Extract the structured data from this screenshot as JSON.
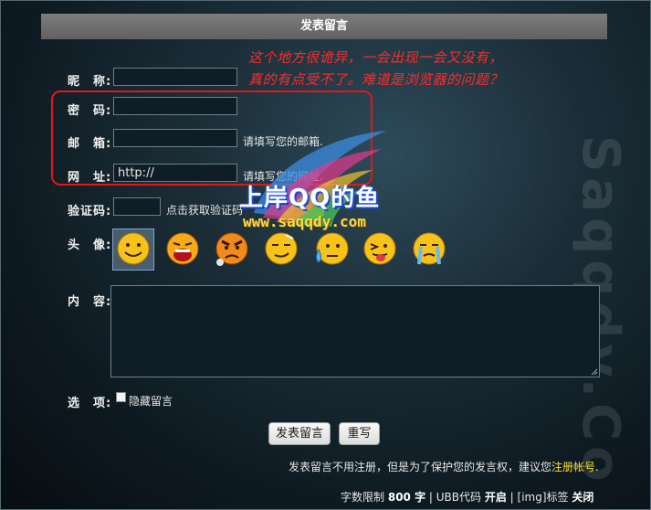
{
  "form": {
    "title": "发表留言",
    "nickname": {
      "label": "昵　称:",
      "value": ""
    },
    "password": {
      "label": "密　码:",
      "value": ""
    },
    "email": {
      "label": "邮　箱:",
      "value": "",
      "hint": "请填写您的邮箱."
    },
    "website": {
      "label": "网　址:",
      "value": "http://",
      "hint": "请填写您的网址."
    },
    "captcha": {
      "label": "验证码:",
      "value": "",
      "hint": "点击获取验证码"
    },
    "avatar_label": "头　像:",
    "avatars": [
      "smile-face",
      "laughing-face",
      "angry-face",
      "smirk-face",
      "sweat-face",
      "tongue-face",
      "crying-face"
    ],
    "content_label": "内　容:",
    "options_label": "选　项:",
    "hide_label": "隐藏留言",
    "submit_label": "发表留言",
    "reset_label": "重写",
    "footer_note_prefix": "发表留言不用注册，但是为了保护您的发言权，建议您",
    "footer_note_link": "注册帐号",
    "footer_note_suffix": ".",
    "limit_prefix": "字数限制",
    "limit_value": "800 字",
    "ubb_label": "UBB代码",
    "ubb_state": "开启",
    "img_label": "[img]标签",
    "img_state": "关闭"
  },
  "annotation": {
    "note_line1": "这个地方很诡异，一会出现一会又没有，",
    "note_line2": "真的有点受不了。难道是浏览器的问题？",
    "box_color": "#e01818"
  },
  "watermark": {
    "site_cn": "上岸QQ的鱼",
    "site_url": "www.saqqdy.com",
    "vertical_text": "Saqqdy.Co"
  }
}
